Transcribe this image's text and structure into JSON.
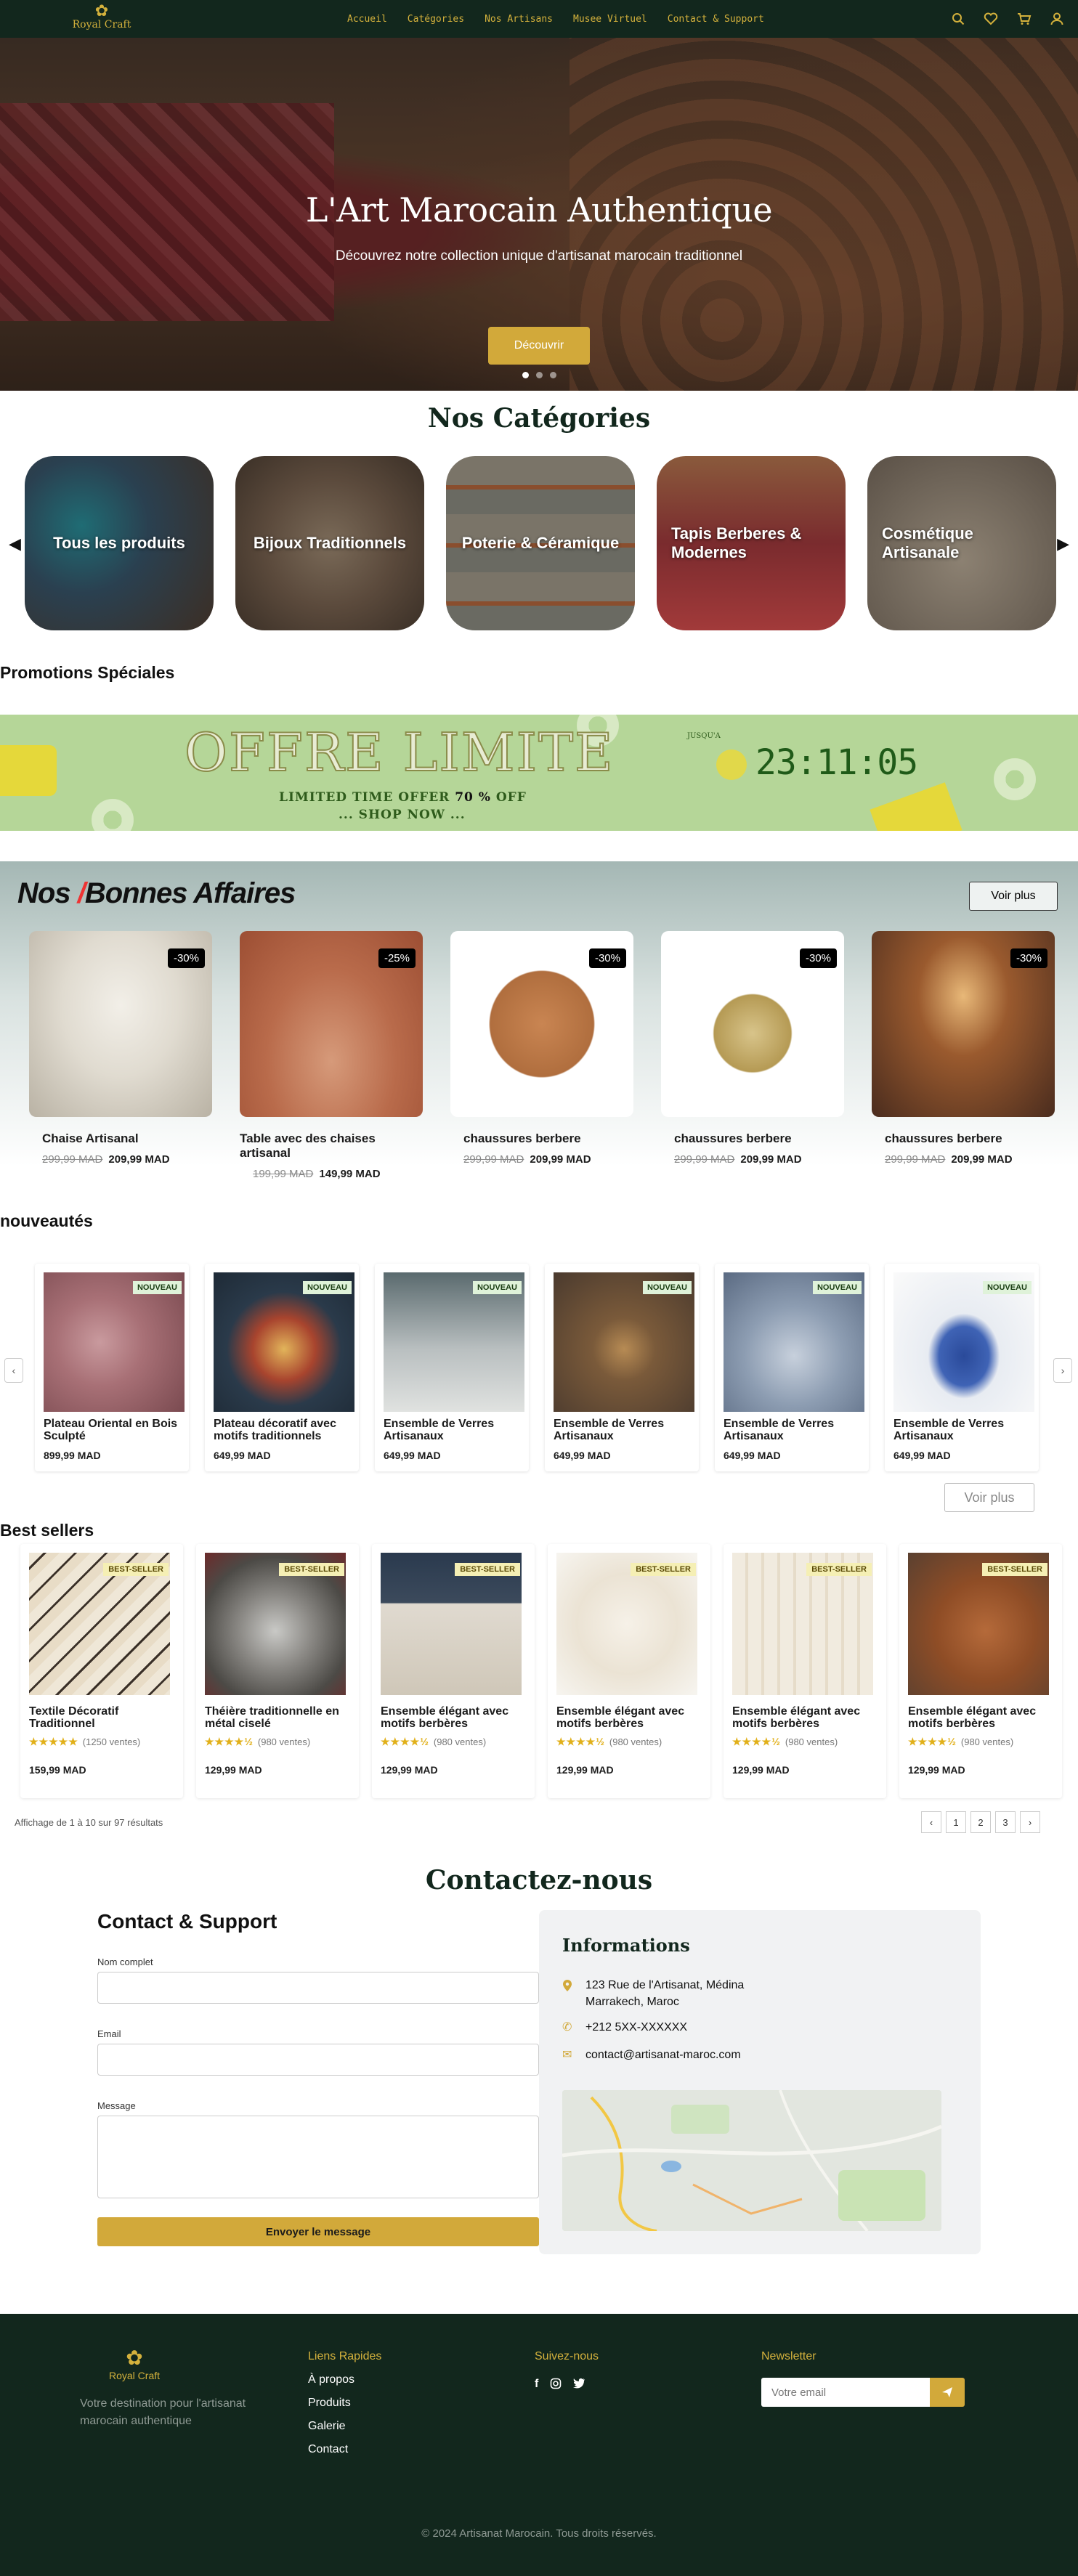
{
  "nav": {
    "logo_text": "Royal Craft",
    "logo_icon": "flower-emblem-icon",
    "links": [
      "Accueil",
      "Catégories",
      "Nos Artisans",
      "Musee Virtuel",
      "Contact & Support"
    ],
    "icons": [
      "search-icon",
      "heart-icon",
      "cart-icon",
      "user-icon"
    ],
    "accent": "#d4b13c",
    "bg": "#12271d"
  },
  "hero": {
    "title": "L'Art Marocain Authentique",
    "subtitle": "Découvrez notre collection unique d'artisanat marocain traditionnel",
    "cta": "Découvrir",
    "active_slide": 1,
    "slide_count": 3
  },
  "categories": {
    "title": "Nos Catégories",
    "items": [
      "Tous les produits",
      "Bijoux Traditionnels",
      "Poterie & Céramique",
      "Tapis Berberes & Modernes",
      "Cosmétique Artisanale"
    ]
  },
  "promotions": {
    "title": "Promotions Spéciales",
    "banner_big": "OFFRE LIMITE",
    "banner_sub_prefix": "LIMITED TIME OFFER ",
    "banner_sub_percent": "70 %",
    "banner_sub_suffix": " OFF",
    "banner_shop": "... SHOP NOW ...",
    "jusqua": "JUSQU'A",
    "timer": "23:11:05",
    "bg": "#b5d698"
  },
  "deals": {
    "title_a": "Nos ",
    "title_b": "Bonnes Affaires",
    "more": "Voir plus",
    "items": [
      {
        "name": "Chaise Artisanal",
        "badge": "-30%",
        "old": "299,99 MAD",
        "new": "209,99 MAD"
      },
      {
        "name": "Table avec des chaises artisanal",
        "badge": "-25%",
        "old": "199,99 MAD",
        "new": "149,99 MAD"
      },
      {
        "name": "chaussures berbere",
        "badge": "-30%",
        "old": "299,99 MAD",
        "new": "209,99 MAD"
      },
      {
        "name": "chaussures berbere",
        "badge": "-30%",
        "old": "299,99 MAD",
        "new": "209,99 MAD"
      },
      {
        "name": "chaussures berbere",
        "badge": "-30%",
        "old": "299,99 MAD",
        "new": "209,99 MAD"
      }
    ]
  },
  "new_arrivals": {
    "title": "nouveautés",
    "badge": "NOUVEAU",
    "more": "Voir plus",
    "items": [
      {
        "name": "Plateau Oriental en Bois Sculpté",
        "price": "899,99  MAD"
      },
      {
        "name": "Plateau décoratif avec motifs traditionnels",
        "price": "649,99 MAD"
      },
      {
        "name": "Ensemble de Verres Artisanaux",
        "price": "649,99  MAD"
      },
      {
        "name": "Ensemble de Verres Artisanaux",
        "price": "649,99  MAD"
      },
      {
        "name": "Ensemble de Verres Artisanaux",
        "price": "649,99  MAD"
      },
      {
        "name": "Ensemble de Verres Artisanaux",
        "price": "649,99  MAD"
      }
    ]
  },
  "best_sellers": {
    "title": "Best sellers",
    "badge": "BEST-SELLER",
    "items": [
      {
        "name": "Textile Décoratif Traditionnel",
        "stars": "★★★★★",
        "rating": 5,
        "sales": "(1250 ventes)",
        "price": "159,99 MAD"
      },
      {
        "name": "Théière traditionnelle en métal ciselé",
        "stars": "★★★★½",
        "rating": 4.5,
        "sales": "(980 ventes)",
        "price": "129,99  MAD"
      },
      {
        "name": "Ensemble élégant avec motifs berbères",
        "stars": "★★★★½",
        "rating": 4.5,
        "sales": "(980 ventes)",
        "price": "129,99 MAD"
      },
      {
        "name": "Ensemble élégant avec motifs berbères",
        "stars": "★★★★½",
        "rating": 4.5,
        "sales": "(980 ventes)",
        "price": "129,99 MAD"
      },
      {
        "name": "Ensemble élégant avec motifs berbères",
        "stars": "★★★★½",
        "rating": 4.5,
        "sales": "(980 ventes)",
        "price": "129,99 MAD"
      },
      {
        "name": "Ensemble élégant avec motifs berbères",
        "stars": "★★★★½",
        "rating": 4.5,
        "sales": "(980 ventes)",
        "price": "129,99 MAD"
      }
    ],
    "results": "Affichage de 1 à 10 sur 97 résultats",
    "pages": [
      "‹",
      "1",
      "2",
      "3",
      "›"
    ]
  },
  "contact": {
    "title": "Contactez-nous",
    "form_title": "Contact & Support",
    "name_label": "Nom complet",
    "email_label": "Email",
    "message_label": "Message",
    "submit": "Envoyer le message",
    "info_title": "Informations",
    "address_line1": "123 Rue de l'Artisanat, Médina",
    "address_line2": "Marrakech, Maroc",
    "phone": "+212 5XX-XXXXXX",
    "email": "contact@artisanat-maroc.com"
  },
  "footer": {
    "logo_text": "Royal Craft",
    "tagline": "Votre destination pour l'artisanat marocain authentique",
    "links_title": "Liens Rapides",
    "links": [
      "À propos",
      "Produits",
      "Galerie",
      "Contact"
    ],
    "social_title": "Suivez-nous",
    "social_icons": [
      "facebook-icon",
      "instagram-icon",
      "twitter-icon"
    ],
    "newsletter_title": "Newsletter",
    "newsletter_placeholder": "Votre email",
    "copyright": "© 2024 Artisanat Marocain. Tous droits réservés."
  }
}
